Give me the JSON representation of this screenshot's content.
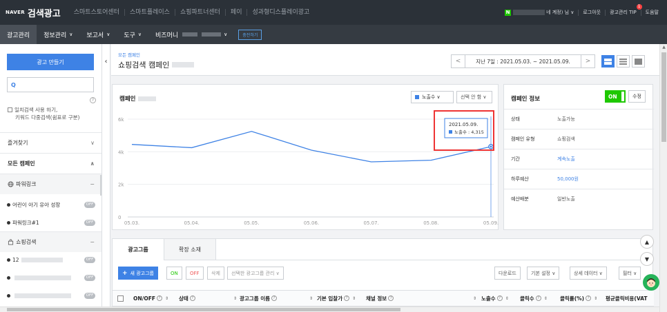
{
  "header": {
    "brand": "NAVER",
    "app_title": "검색광고",
    "top_nav": [
      "스마트스토어센터",
      "스마트플레이스",
      "쇼핑파트너센터",
      "페이",
      "성과형디스플레이광고"
    ],
    "account_badge": "N",
    "account_suffix": "네 계정) 님 ∨",
    "logout": "로그아웃",
    "tip": "광고관리 TIP",
    "tip_count": "1",
    "help": "도움말"
  },
  "navbar": {
    "items": [
      {
        "label": "광고관리",
        "chevron": ""
      },
      {
        "label": "정보관리",
        "chevron": "∨"
      },
      {
        "label": "보고서",
        "chevron": "∨"
      },
      {
        "label": "도구",
        "chevron": "∨"
      },
      {
        "label": "비즈머니",
        "chevron": "∨"
      }
    ],
    "charge_button": "충전하기"
  },
  "sidebar": {
    "create_button": "광고 만들기",
    "search_icon": "search-icon",
    "help_mark": "?",
    "exact_search_line1": "일치검색 사용 하기,",
    "exact_search_line2": "키워드 다중검색(쉼표로 구분)",
    "favorites": "즐겨찾기",
    "favorites_chev": "∨",
    "all_campaigns": "모든 캠페인",
    "all_campaigns_chev": "∧",
    "powerlink_group": "파워링크",
    "collapse_mark": "−",
    "item1": "어린이 아기 유아 성장",
    "item2": "파워링크#1",
    "shopping_group": "쇼핑검색",
    "item3": "12",
    "off_label": "OFF"
  },
  "main": {
    "breadcrumb": "모든 캠페인",
    "title": "쇼핑검색 캠페인",
    "date_range": "지난 7일 : 2021.05.03. ~ 2021.05.09.",
    "prev": "<",
    "next": ">"
  },
  "chart_panel": {
    "title": "캠페인",
    "series_select": "노출수 ∨",
    "compare_select": "선택 안 함 ∨",
    "tooltip_date": "2021.05.09.",
    "tooltip_value": "노출수 : 4,315"
  },
  "chart_data": {
    "type": "line",
    "x": [
      "05.03.",
      "05.04.",
      "05.05.",
      "05.06.",
      "05.07.",
      "05.08.",
      "05.09."
    ],
    "series": [
      {
        "values": [
          4450,
          4250,
          5250,
          4100,
          3380,
          3480,
          4315
        ]
      }
    ],
    "ylim": [
      0,
      6000
    ],
    "yticks": [
      0,
      2000,
      4000,
      6000
    ],
    "ytick_labels": [
      "0",
      "2k",
      "4k",
      "6k"
    ],
    "grid": true,
    "color": "#3e82e5"
  },
  "info_panel": {
    "title": "캠페인 정보",
    "toggle": "ON",
    "edit": "수정",
    "rows": [
      {
        "key": "상태",
        "value": "노출가능"
      },
      {
        "key": "캠페인 유형",
        "value": "쇼핑검색"
      },
      {
        "key": "기간",
        "value": "계속노출"
      },
      {
        "key": "하루예산",
        "value": "50,000원"
      },
      {
        "key": "예산배분",
        "value": "일반노출"
      }
    ]
  },
  "bottom_panel": {
    "tabs": [
      "광고그룹",
      "확장 소재"
    ],
    "toolbar": {
      "new_group": "새 광고그룹",
      "on": "ON",
      "off": "OFF",
      "delete": "삭제",
      "manage": "선택한 광고그룹 관리 ∨",
      "download": "다운로드",
      "default_settings": "기본 설정 ∨",
      "detail_data": "상세 데이터 ∨",
      "filter": "필터 ∨"
    },
    "columns": [
      "ON/OFF",
      "상태",
      "광고그룹 이름",
      "기본 입찰가",
      "채널 정보",
      "노출수",
      "클릭수",
      "클릭률(%)",
      "평균클릭비용(VAT"
    ]
  }
}
